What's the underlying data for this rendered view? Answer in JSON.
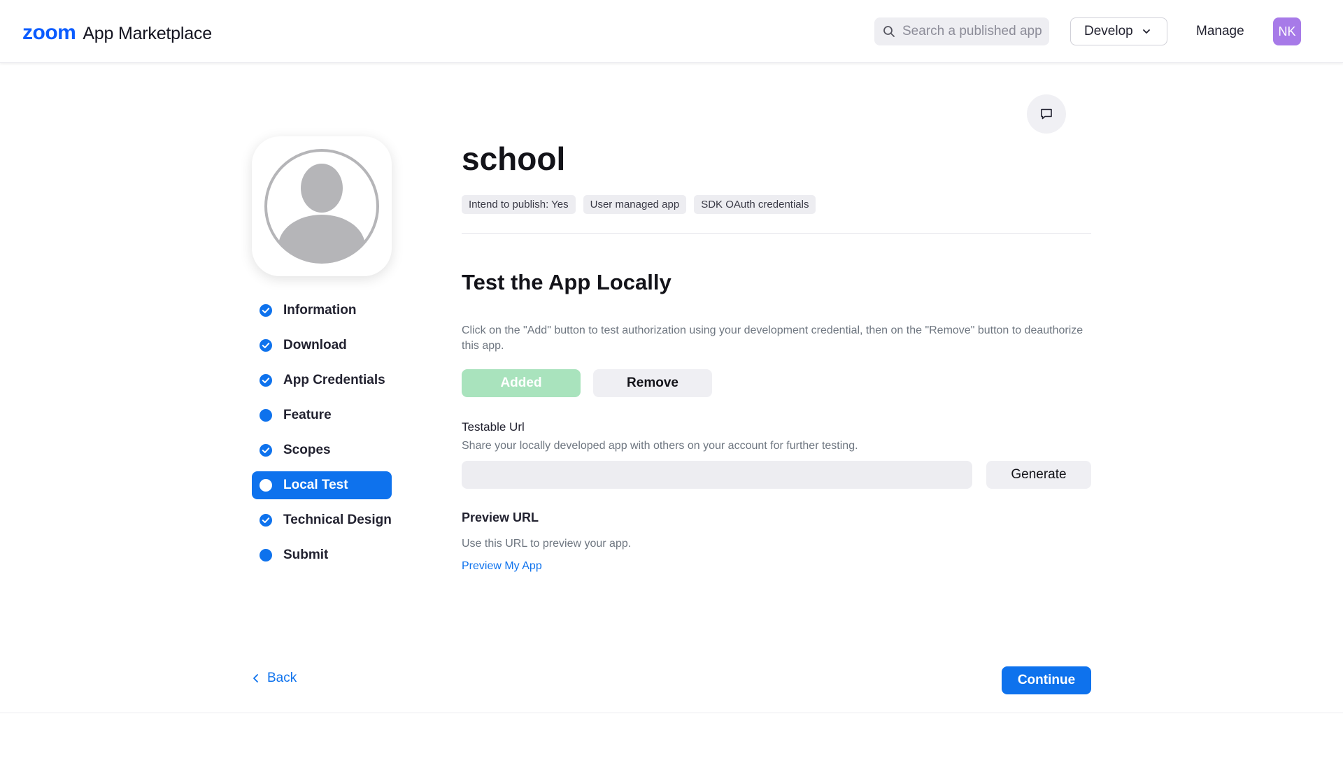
{
  "header": {
    "brand_logo": "zoom",
    "brand_name": "App Marketplace",
    "search_placeholder": "Search a published app",
    "develop_label": "Develop",
    "manage_label": "Manage",
    "avatar_initials": "NK"
  },
  "app": {
    "name": "school",
    "tags": [
      "Intend to publish: Yes",
      "User managed app",
      "SDK OAuth credentials"
    ]
  },
  "sidebar": {
    "items": [
      {
        "label": "Information",
        "state": "complete"
      },
      {
        "label": "Download",
        "state": "complete"
      },
      {
        "label": "App Credentials",
        "state": "complete"
      },
      {
        "label": "Feature",
        "state": "incomplete"
      },
      {
        "label": "Scopes",
        "state": "complete"
      },
      {
        "label": "Local Test",
        "state": "active"
      },
      {
        "label": "Technical Design",
        "state": "complete"
      },
      {
        "label": "Submit",
        "state": "incomplete"
      }
    ]
  },
  "main": {
    "section_title": "Test the App Locally",
    "description": "Click on the \"Add\" button to test authorization using your development credential, then on the \"Remove\" button to deauthorize this app.",
    "added_label": "Added",
    "remove_label": "Remove",
    "testable_url_label": "Testable Url",
    "testable_url_help": "Share your locally developed app with others on your account for further testing.",
    "testable_url_value": "",
    "generate_label": "Generate",
    "preview_title": "Preview URL",
    "preview_help": "Use this URL to preview your app.",
    "preview_link": "Preview My App"
  },
  "footer": {
    "back_label": "Back",
    "continue_label": "Continue"
  },
  "colors": {
    "brand_blue": "#0b5cff",
    "primary_blue": "#0e72ed",
    "added_green": "#a9e3bd",
    "avatar_purple": "#a77ae8"
  }
}
